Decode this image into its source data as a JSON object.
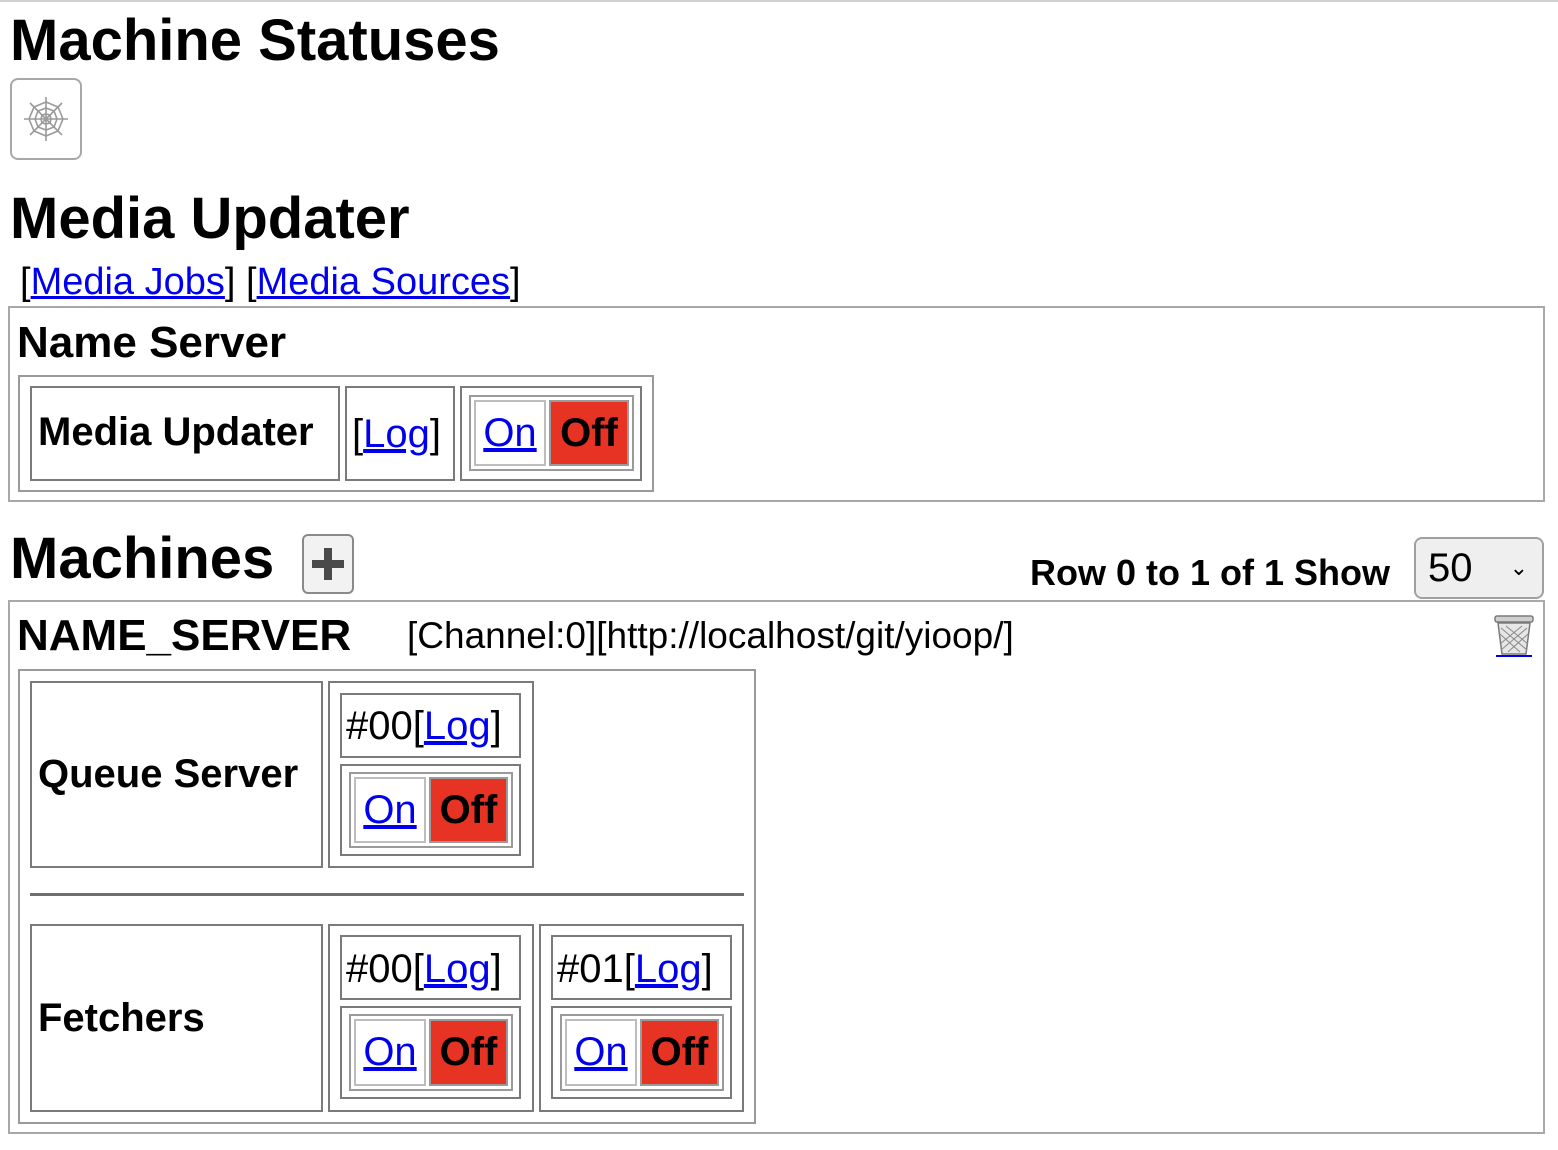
{
  "page": {
    "title": "Machine Statuses"
  },
  "media_updater": {
    "heading": "Media Updater",
    "links": {
      "jobs": "Media Jobs",
      "sources": "Media Sources"
    },
    "name_server": {
      "heading": "Name Server",
      "row_label": "Media Updater",
      "log": "Log",
      "on": "On",
      "off": "Off"
    }
  },
  "machines": {
    "heading": "Machines",
    "pagination": {
      "text": "Row 0 to 1 of 1 Show",
      "show_value": "50"
    },
    "items": [
      {
        "name": "NAME_SERVER",
        "channel": "[Channel:0]",
        "url": "[http://localhost/git/yioop/]",
        "queue_server": {
          "label": "Queue Server",
          "id": "#00",
          "log": "Log",
          "on": "On",
          "off": "Off"
        },
        "fetchers": {
          "label": "Fetchers",
          "items": [
            {
              "id": "#00",
              "log": "Log",
              "on": "On",
              "off": "Off"
            },
            {
              "id": "#01",
              "log": "Log",
              "on": "On",
              "off": "Off"
            }
          ]
        }
      }
    ]
  },
  "icons": {
    "spider": "spider-web-icon",
    "add": "plus-icon",
    "delete": "trash-icon"
  },
  "colors": {
    "off_active": "#e63323",
    "link": "#0000ee"
  }
}
